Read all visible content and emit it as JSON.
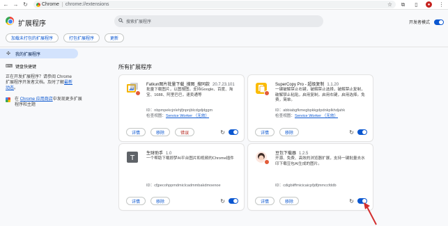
{
  "browser": {
    "chip_label": "Chrome",
    "url": "chrome://extensions"
  },
  "header": {
    "title": "扩展程序",
    "search_placeholder": "搜索扩展程序",
    "dev_mode_label": "开发者模式",
    "dev_mode_on": true
  },
  "actions": {
    "load_unpacked": "加载未打包的扩展程序",
    "pack": "打包扩展程序",
    "update": "更新"
  },
  "sidebar": {
    "items": [
      {
        "label": "我的扩展程序",
        "icon": "puzzle-icon",
        "active": true
      },
      {
        "label": "键盘快捷键",
        "icon": "keyboard-icon",
        "active": false
      }
    ],
    "note_prefix": "正在开发扩展程序？请参阅 Chrome 扩展程序开发者文档。及时了解",
    "note_link": "最新动态",
    "note_suffix": "。",
    "store_prefix": "在",
    "store_link": "Chrome 应用商店",
    "store_suffix": "中发现更多扩展程序和主题"
  },
  "main": {
    "section_title": "所有扩展程序",
    "details_label": "详情",
    "remove_label": "移除",
    "errors_label": "错误",
    "id_prefix": "ID：",
    "inspect_label": "检查视图：",
    "cards": [
      {
        "name": "Fatkun图片批量下载_搜图_搜同款",
        "version": "20.7.23.101",
        "description": "批量下载图片，以图搜图，支持Google、百度、淘宝、1688、阿里巴巴，速卖通等",
        "id": "nbpmpekcjnlehjfjnpnjblcdgdjdggm",
        "inspect_link": "Service Worker （无效）",
        "enabled": true,
        "has_errors": true
      },
      {
        "name": "SuperCopy Pro - 超级复制",
        "version": "1.1.20",
        "description": "一键破解禁止右键，破解禁止选择，破解禁止复制，破解禁止粘贴，启用复制，启用右键，启用选择。免费，简单。",
        "id": "abbiabgfkmegbpkkgdpdnkplkhdjahk",
        "inspect_link": "Service Worker （无效）",
        "enabled": true,
        "has_errors": false
      },
      {
        "name": "生财助手",
        "version": "1.0",
        "description": "一个帮助下载即梦AI平台图片和视频的Chrome插件",
        "id": "cfjpecohppmdmiclcadmmbakdmoenoe",
        "inspect_link": "",
        "enabled": true,
        "has_errors": false
      },
      {
        "name": "豆包下载器",
        "version": "1.2.5",
        "description": "开源、免费、高效的浏览器扩展，支持一键批量去水印下载豆包AI生成的图片。",
        "id": "cdigbiiffmicicaicpfjdfjmmccfddb",
        "inspect_link": "",
        "enabled": true,
        "has_errors": false
      }
    ]
  },
  "colors": {
    "accent": "#0b57d0",
    "arrow": "#d32f2f",
    "error": "#b3261e"
  }
}
